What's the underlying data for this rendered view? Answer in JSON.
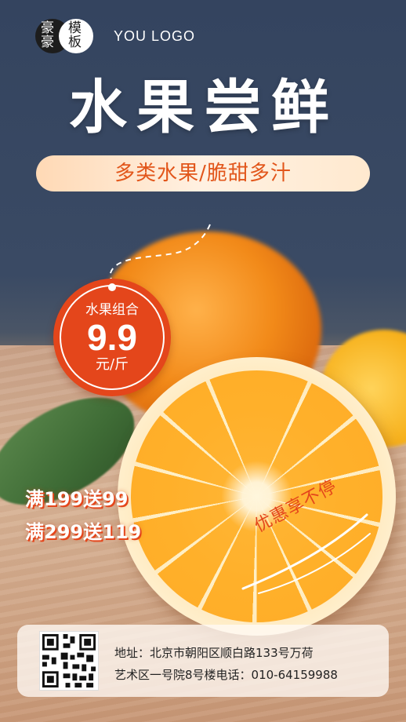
{
  "logo": {
    "chars": [
      "豪",
      "豪",
      "模",
      "板"
    ],
    "text": "YOU LOGO"
  },
  "title": "水果尝鲜",
  "subtitle": "多类水果/脆甜多汁",
  "price_tag": {
    "label": "水果组合",
    "value": "9.9",
    "unit": "元/斤"
  },
  "promotions": [
    "满199送99",
    "满299送119"
  ],
  "slogan": "优惠享不停",
  "footer": {
    "address_line1": "地址：北京市朝阳区顺白路133号万荷",
    "address_line2": "艺术区一号院8号楼电话：010-64159988"
  },
  "colors": {
    "accent": "#e4461b",
    "background_top": "#34445f",
    "orange": "#ffb02a"
  },
  "icons": [
    "qr-code-icon"
  ]
}
